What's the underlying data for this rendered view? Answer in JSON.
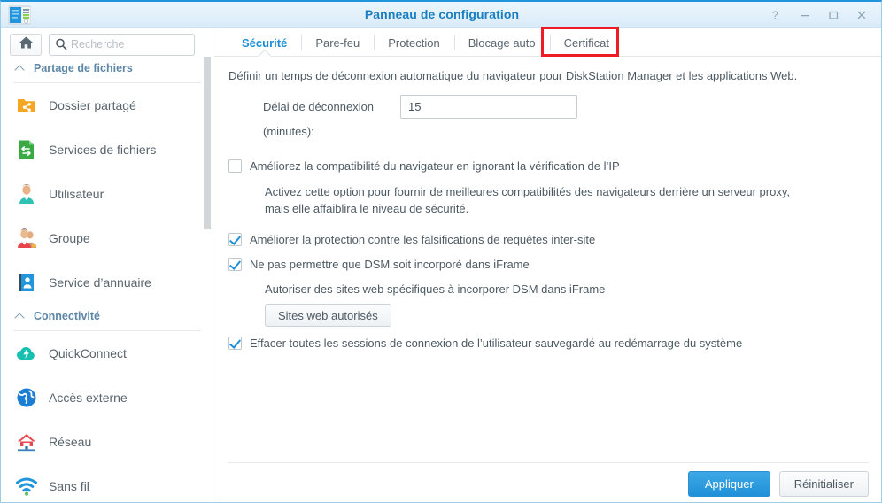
{
  "window": {
    "title": "Panneau de configuration",
    "icon": "control-panel-icon",
    "help_label": "?",
    "minimize_label": "—",
    "maximize_label": "□",
    "close_label": "✕"
  },
  "sidebar": {
    "home_button": "home-icon",
    "search": {
      "placeholder": "Recherche",
      "value": ""
    },
    "groups": [
      {
        "label": "Partage de fichiers",
        "collapse_icon": "chevron-up-icon",
        "items": [
          {
            "label": "Dossier partagé",
            "icon": "shared-folder-icon"
          },
          {
            "label": "Services de fichiers",
            "icon": "file-services-icon"
          },
          {
            "label": "Utilisateur",
            "icon": "user-icon"
          },
          {
            "label": "Groupe",
            "icon": "group-icon"
          },
          {
            "label": "Service d’annuaire",
            "icon": "directory-service-icon"
          }
        ]
      },
      {
        "label": "Connectivité",
        "collapse_icon": "chevron-up-icon",
        "items": [
          {
            "label": "QuickConnect",
            "icon": "quickconnect-icon"
          },
          {
            "label": "Accès externe",
            "icon": "external-access-icon"
          },
          {
            "label": "Réseau",
            "icon": "network-icon"
          },
          {
            "label": "Sans fil",
            "icon": "wireless-icon"
          }
        ]
      }
    ]
  },
  "main": {
    "tabs": [
      {
        "label": "Sécurité",
        "active": true,
        "highlighted": false
      },
      {
        "label": "Pare-feu",
        "active": false,
        "highlighted": false
      },
      {
        "label": "Protection",
        "active": false,
        "highlighted": false
      },
      {
        "label": "Blocage auto",
        "active": false,
        "highlighted": false
      },
      {
        "label": "Certificat",
        "active": false,
        "highlighted": true
      }
    ],
    "intro": "Définir un temps de déconnexion automatique du navigateur pour DiskStation Manager et les applications Web.",
    "timeout_field": {
      "label_line1": "Délai de déconnexion",
      "label_line2": "(minutes):",
      "value": "15"
    },
    "checkbox_ip": {
      "label": "Améliorez la compatibilité du navigateur en ignorant la vérification de l’IP",
      "checked": false
    },
    "help_ip_line1": "Activez cette option pour fournir de meilleures compatibilités des navigateurs derrière un serveur proxy,",
    "help_ip_line2": "mais elle affaiblira le niveau de sécurité.",
    "checkbox_csrf": {
      "label": "Améliorer la protection contre les falsifications de requêtes inter-site",
      "checked": true
    },
    "checkbox_iframe": {
      "label": "Ne pas permettre que DSM soit incorporé dans iFrame",
      "checked": true
    },
    "iframe_hint": "Autoriser des sites web spécifiques à incorporer DSM dans iFrame",
    "allowed_sites_button": "Sites web autorisés",
    "checkbox_clear_sessions": {
      "label": "Effacer toutes les sessions de connexion de l’utilisateur sauvegardé au redémarrage du système",
      "checked": true
    }
  },
  "footer": {
    "apply_label": "Appliquer",
    "reset_label": "Réinitialiser"
  },
  "colors": {
    "accent": "#1b8fd6",
    "title": "#1a7fc1",
    "highlight": "#ee1c24",
    "text": "#4d5a64"
  }
}
